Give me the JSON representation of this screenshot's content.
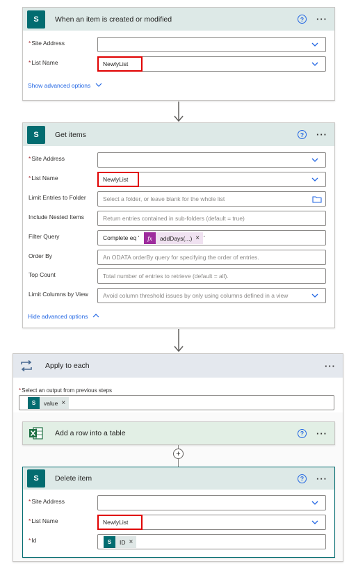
{
  "trigger": {
    "title": "When an item is created or modified",
    "site_address_label": "Site Address",
    "list_name_label": "List Name",
    "list_name_value": "NewlyList",
    "show_advanced": "Show advanced options"
  },
  "get_items": {
    "title": "Get items",
    "site_address_label": "Site Address",
    "list_name_label": "List Name",
    "list_name_value": "NewlyList",
    "limit_folder_label": "Limit Entries to Folder",
    "limit_folder_placeholder": "Select a folder, or leave blank for the whole list",
    "nested_label": "Include Nested Items",
    "nested_placeholder": "Return entries contained in sub-folders (default = true)",
    "filter_label": "Filter Query",
    "filter_prefix": "Complete eq '",
    "filter_expression": "addDays(...)",
    "filter_suffix": "'",
    "order_label": "Order By",
    "order_placeholder": "An ODATA orderBy query for specifying the order of entries.",
    "top_label": "Top Count",
    "top_placeholder": "Total number of entries to retrieve (default = all).",
    "limit_view_label": "Limit Columns by View",
    "limit_view_placeholder": "Avoid column threshold issues by only using columns defined in a view",
    "hide_advanced": "Hide advanced options"
  },
  "apply_each": {
    "title": "Apply to each",
    "output_label": "Select an output from previous steps",
    "output_token": "value"
  },
  "add_row": {
    "title": "Add a row into a table"
  },
  "delete_item": {
    "title": "Delete item",
    "site_address_label": "Site Address",
    "list_name_label": "List Name",
    "list_name_value": "NewlyList",
    "id_label": "Id",
    "id_token": "ID"
  },
  "icons": {
    "sharepoint": "sharepoint-icon",
    "excel": "excel-icon",
    "loop": "loop-icon",
    "help": "help-icon",
    "more": "more-icon",
    "chevron": "chevron-down-icon",
    "folder": "folder-icon",
    "plus": "plus-icon"
  },
  "colors": {
    "accent": "#2266e3",
    "sharepoint": "#036c70",
    "excel": "#1d6f42",
    "loop": "#486991",
    "highlight": "#e00000",
    "expression": "#9e2c9d"
  }
}
